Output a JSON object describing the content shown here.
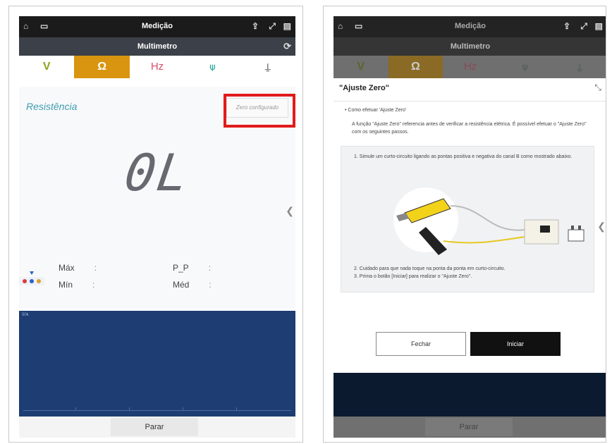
{
  "app": {
    "status_title": "Medição",
    "appbar_title": "Multimetro",
    "tabs": [
      "V",
      "Ω",
      "Hz",
      "",
      ""
    ],
    "active_tab": 1
  },
  "measure": {
    "mode_label": "Resistência",
    "zero_button": "Zero configurado",
    "reading": "0L",
    "stats": {
      "max_label": "Máx",
      "min_label": "Mín",
      "pp_label": "P_P",
      "avg_label": "Méd",
      "colon": ":"
    },
    "graph_label": "50k",
    "stop_button": "Parar"
  },
  "dialog": {
    "title": "\"Ajuste Zero\"",
    "section": "• Como efetuar 'Ajuste Zero'",
    "intro": "A função \"Ajuste Zero\" referencia antes de verificar a resistência elétrica. É possível efetuar o \"Ajuste Zero\" com os seguintes passos.",
    "step1": "1. Simule um curto-circuito ligando as pontas positiva e negativa do canal B como mostrado abaixo.",
    "step2": "2. Cuidado para que nada toque na ponta da ponta em curto-circuito.",
    "step3": "3. Prima o botão [Iniciar] para realizar o \"Ajuste Zero\".",
    "cancel_button": "Fechar",
    "start_button": "Iniciar"
  },
  "colors": {
    "accent": "#d9950f",
    "highlight": "#e21b1b",
    "graph_bg": "#1d3d73",
    "label": "#3f9db3"
  },
  "icons": [
    "home-icon",
    "image-icon",
    "share-icon",
    "expand-icon",
    "menu-icon",
    "gear-icon",
    "close-icon",
    "arrow-left-icon"
  ]
}
